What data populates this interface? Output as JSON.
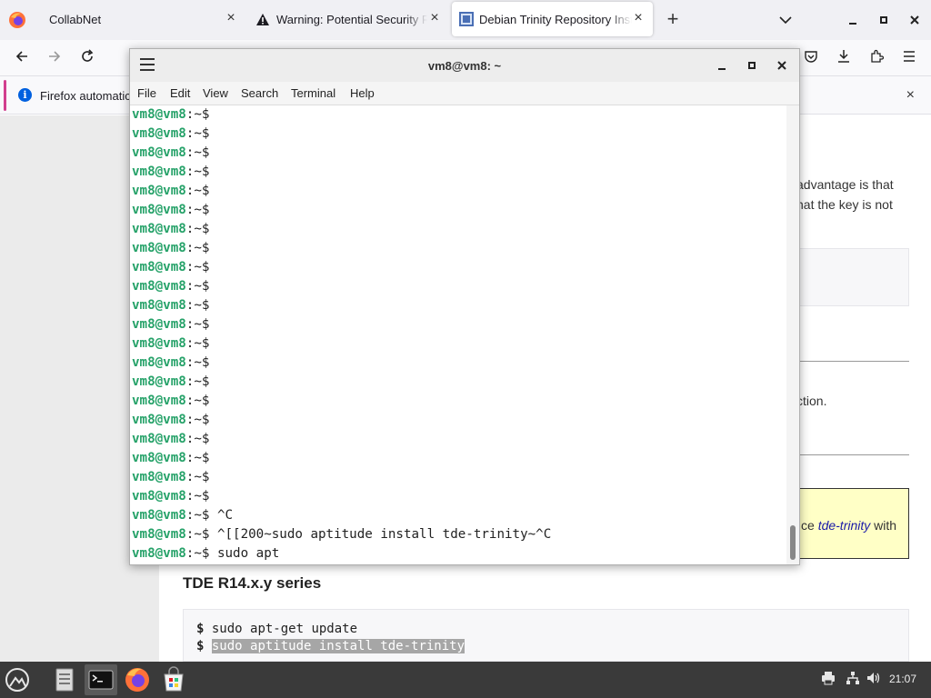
{
  "browser": {
    "tabs": [
      {
        "title": "CollabNet"
      },
      {
        "title": "Warning: Potential Security R"
      },
      {
        "title": "Debian Trinity Repository Inst"
      }
    ],
    "new_tab": "+",
    "notification": "Firefox automatic"
  },
  "page": {
    "frag1": "advantage is that",
    "frag2": "nat the key is not",
    "frag3": "ction.",
    "note_pre": "ce ",
    "note_em": "tde-trinity",
    "note_post": " with",
    "heading": "TDE R14.x.y series",
    "code_line1_prompt": "$",
    "code_line1_cmd": "sudo apt-get update",
    "code_line2_prompt": "$",
    "code_line2_cmd": "sudo aptitude install tde-trinity"
  },
  "terminal": {
    "title": "vm8@vm8: ~",
    "menu": [
      "File",
      "Edit",
      "View",
      "Search",
      "Terminal",
      "Help"
    ],
    "prompt": "vm8@vm8",
    "lines": [
      {
        "path": ":~$",
        "cmd": ""
      },
      {
        "path": ":~$",
        "cmd": ""
      },
      {
        "path": ":~$",
        "cmd": ""
      },
      {
        "path": ":~$",
        "cmd": ""
      },
      {
        "path": ":~$",
        "cmd": ""
      },
      {
        "path": ":~$",
        "cmd": ""
      },
      {
        "path": ":~$",
        "cmd": ""
      },
      {
        "path": ":~$",
        "cmd": ""
      },
      {
        "path": ":~$",
        "cmd": ""
      },
      {
        "path": ":~$",
        "cmd": ""
      },
      {
        "path": ":~$",
        "cmd": ""
      },
      {
        "path": ":~$",
        "cmd": ""
      },
      {
        "path": ":~$",
        "cmd": ""
      },
      {
        "path": ":~$",
        "cmd": ""
      },
      {
        "path": ":~$",
        "cmd": ""
      },
      {
        "path": ":~$",
        "cmd": ""
      },
      {
        "path": ":~$",
        "cmd": ""
      },
      {
        "path": ":~$",
        "cmd": ""
      },
      {
        "path": ":~$",
        "cmd": ""
      },
      {
        "path": ":~$",
        "cmd": ""
      },
      {
        "path": ":~$",
        "cmd": ""
      },
      {
        "path": ":~$",
        "cmd": " ^C"
      },
      {
        "path": ":~$",
        "cmd": " ^[[200~sudo aptitude install tde-trinity~^C"
      },
      {
        "path": ":~$",
        "cmd": " sudo apt"
      }
    ]
  },
  "taskbar": {
    "clock": "21:07"
  }
}
